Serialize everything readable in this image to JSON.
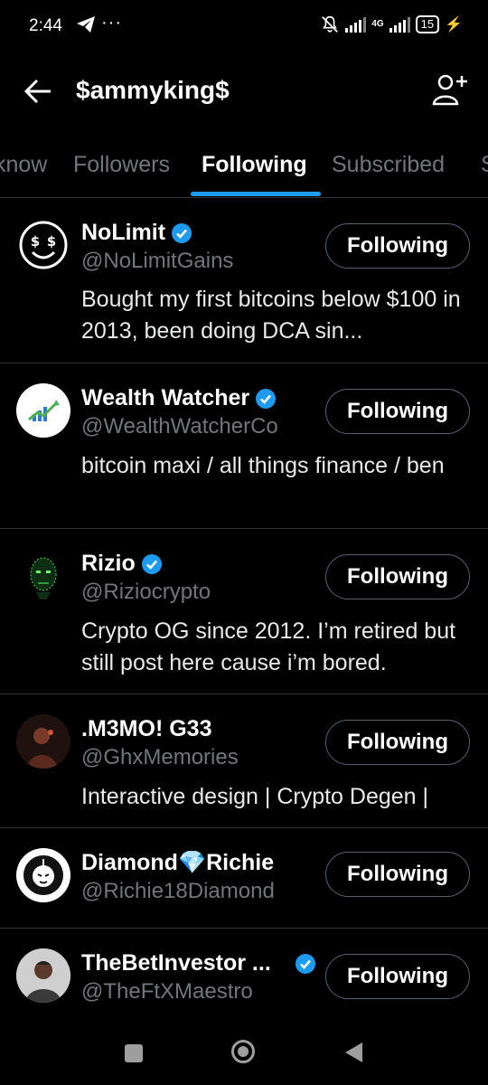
{
  "status_bar": {
    "time": "2:44",
    "dots": "···",
    "network": "4G",
    "battery": "15"
  },
  "header": {
    "title": "$ammyking$"
  },
  "tabs": [
    {
      "label": "know"
    },
    {
      "label": "Followers"
    },
    {
      "label": "Following",
      "active": true
    },
    {
      "label": "Subscribed"
    },
    {
      "label": "S"
    }
  ],
  "accent_color": "#1d9bf0",
  "users": [
    {
      "name": "NoLimit",
      "handle": "@NoLimitGains",
      "verified": true,
      "bio": "Bought my first bitcoins below $100 in 2013, been doing DCA sin...",
      "button": "Following",
      "avatar_icon": "dollar-smiley-icon"
    },
    {
      "name": "Wealth Watcher",
      "handle": "@WealthWatcherCo",
      "verified": true,
      "bio": "bitcoin maxi / all things finance / ben",
      "button": "Following",
      "avatar_icon": "chart-growth-icon"
    },
    {
      "name": "Rizio",
      "handle": "@Riziocrypto",
      "verified": true,
      "bio": "Crypto OG since 2012. I’m retired but still post here cause i’m bored.",
      "button": "Following",
      "avatar_icon": "matrix-head-icon"
    },
    {
      "name": ".M3MO! G33",
      "handle": "@GhxMemories",
      "verified": false,
      "bio": "Interactive design | Crypto Degen |",
      "button": "Following",
      "avatar_icon": "portrait-photo-icon"
    },
    {
      "name_before": "Diamond",
      "name_gem": "💎",
      "name_after": "Richie",
      "handle": "@Richie18Diamond",
      "verified": false,
      "bio": "",
      "button": "Following",
      "avatar_icon": "lion-logo-icon"
    },
    {
      "name": "TheBetInvestor ...",
      "handle": "@TheFtXMaestro",
      "verified": true,
      "bio": "",
      "button": "Following",
      "avatar_icon": "person-photo-icon"
    }
  ]
}
